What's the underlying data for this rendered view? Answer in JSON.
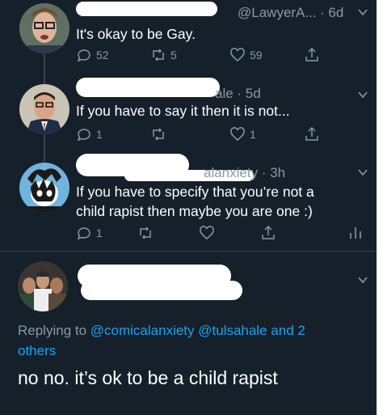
{
  "tweets": [
    {
      "handle": "@LawyerA...",
      "time": "· 6d",
      "text": "It's okay to be Gay.",
      "replies": "52",
      "retweets": "5",
      "likes": "59"
    },
    {
      "handle": "ale · 5d",
      "text": "If you have to say it then it is not...",
      "replies": "1",
      "retweets": "",
      "likes": "1"
    },
    {
      "handle": "alanxiety · 3h",
      "text": "If you have to specify that you’re not a child rapist then maybe you are one :)",
      "replies": "1",
      "retweets": "",
      "likes": ""
    }
  ],
  "main": {
    "replying_prefix": "Replying to ",
    "mention1": "@comicalanxiety",
    "mention2": "@tulsahale",
    "and_text": " and 2",
    "others": "others",
    "text": "no no. it’s ok to be a child rapist"
  }
}
